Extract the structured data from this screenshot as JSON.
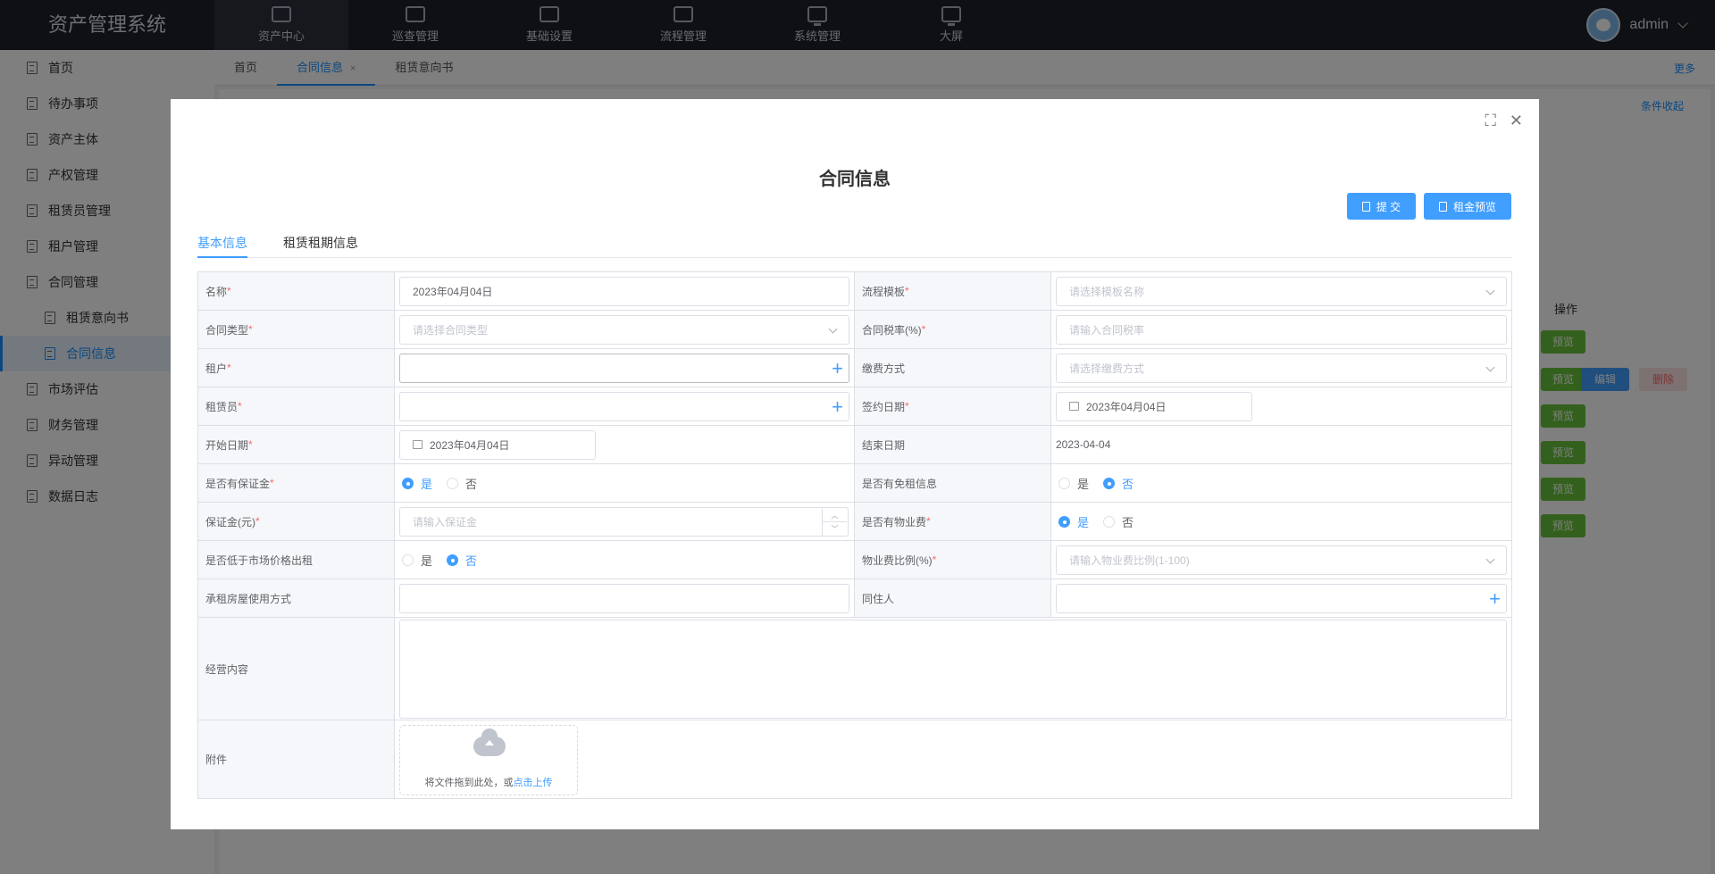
{
  "app": {
    "title": "资产管理系统",
    "user": "admin"
  },
  "nav": [
    {
      "label": "资产中心",
      "icon": "board-icon"
    },
    {
      "label": "巡查管理",
      "icon": "board-icon"
    },
    {
      "label": "基础设置",
      "icon": "board-icon"
    },
    {
      "label": "流程管理",
      "icon": "board-icon"
    },
    {
      "label": "系统管理",
      "icon": "monitor-icon"
    },
    {
      "label": "大屏",
      "icon": "monitor-icon"
    }
  ],
  "sidebar": {
    "items": [
      {
        "label": "首页"
      },
      {
        "label": "待办事项"
      },
      {
        "label": "资产主体"
      },
      {
        "label": "产权管理"
      },
      {
        "label": "租赁员管理"
      },
      {
        "label": "租户管理"
      },
      {
        "label": "合同管理"
      },
      {
        "label": "租赁意向书"
      },
      {
        "label": "合同信息"
      },
      {
        "label": "市场评估"
      },
      {
        "label": "财务管理"
      },
      {
        "label": "异动管理"
      },
      {
        "label": "数据日志"
      }
    ]
  },
  "tabs": [
    {
      "label": "首页"
    },
    {
      "label": "合同信息"
    },
    {
      "label": "租赁意向书"
    }
  ],
  "tab_close": "×",
  "more": "更多",
  "background": {
    "filter_toggle": "条件收起",
    "ops_header": "操作",
    "preview": "预览",
    "edit": "编辑",
    "delete": "删除"
  },
  "modal": {
    "title": "合同信息",
    "submit": "提 交",
    "rent_preview": "租金预览",
    "form_tabs": [
      "基本信息",
      "租赁租期信息"
    ],
    "fields": {
      "name_label": "名称",
      "name_value": "2023年04月04日",
      "template_label": "流程模板",
      "template_ph": "请选择模板名称",
      "type_label": "合同类型",
      "type_ph": "请选择合同类型",
      "tax_label": "合同税率(%)",
      "tax_ph": "请输入合同税率",
      "tenant_label": "租户",
      "payment_label": "缴费方式",
      "payment_ph": "请选择缴费方式",
      "lessor_label": "租赁员",
      "sign_label": "签约日期",
      "sign_value": "2023年04月04日",
      "start_label": "开始日期",
      "start_value": "2023年04月04日",
      "end_label": "结束日期",
      "end_value": "2023-04-04",
      "deposit_q_label": "是否有保证金",
      "free_label": "是否有免租信息",
      "deposit_label": "保证金(元)",
      "deposit_ph": "请输入保证金",
      "property_label": "是否有物业费",
      "below_label": "是否低于市场价格出租",
      "property_ratio_label": "物业费比例(%)",
      "property_ratio_ph": "请输入物业费比例(1-100)",
      "usage_label": "承租房屋使用方式",
      "cohabitant_label": "同住人",
      "business_label": "经营内容",
      "attach_label": "附件",
      "yes": "是",
      "no": "否",
      "upload_text": "将文件拖到此处，或",
      "upload_link": "点击上传"
    }
  }
}
